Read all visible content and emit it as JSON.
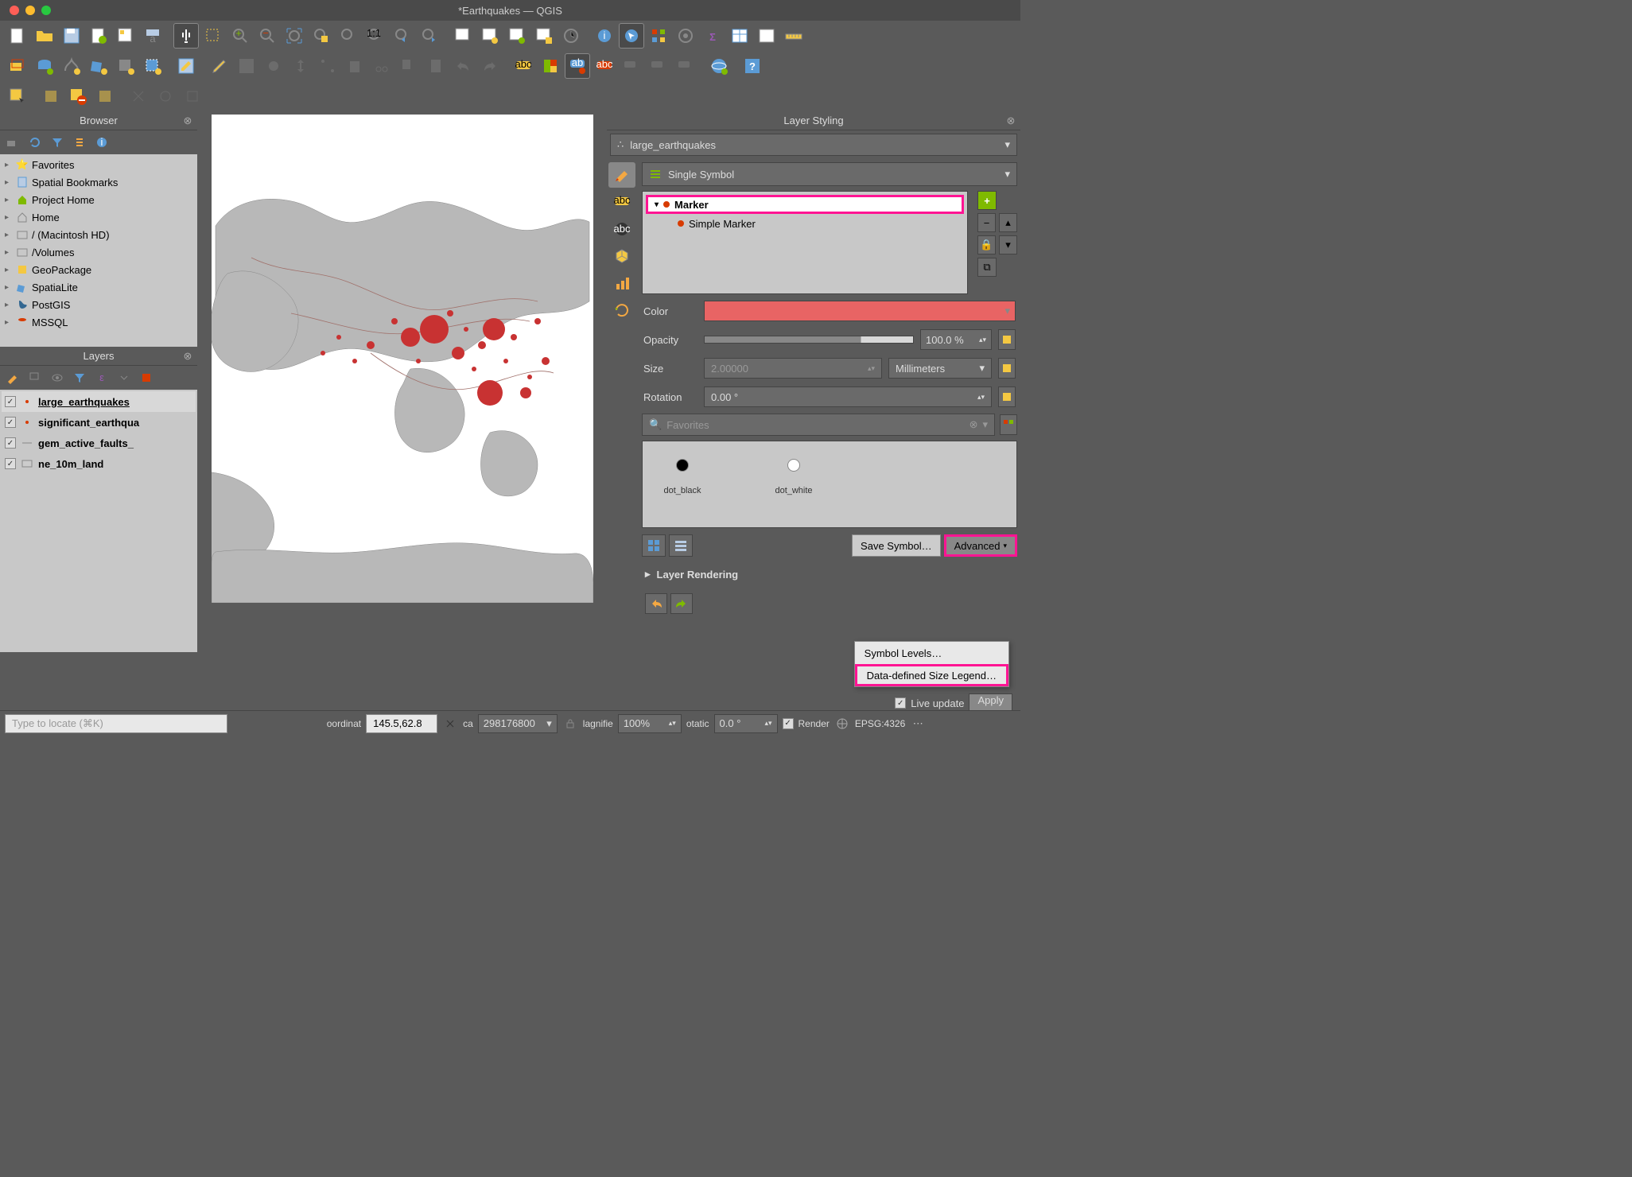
{
  "window": {
    "title": "*Earthquakes — QGIS"
  },
  "browser": {
    "title": "Browser",
    "items": [
      {
        "label": "Favorites",
        "icon": "star"
      },
      {
        "label": "Spatial Bookmarks",
        "icon": "bookmark"
      },
      {
        "label": "Project Home",
        "icon": "home-green"
      },
      {
        "label": "Home",
        "icon": "home"
      },
      {
        "label": "/ (Macintosh HD)",
        "icon": "folder"
      },
      {
        "label": "/Volumes",
        "icon": "folder"
      },
      {
        "label": "GeoPackage",
        "icon": "geopackage"
      },
      {
        "label": "SpatiaLite",
        "icon": "spatialite"
      },
      {
        "label": "PostGIS",
        "icon": "postgis"
      },
      {
        "label": "MSSQL",
        "icon": "mssql"
      }
    ]
  },
  "layers": {
    "title": "Layers",
    "items": [
      {
        "name": "large_earthquakes",
        "checked": true,
        "selected": true,
        "underline": true
      },
      {
        "name": "significant_earthqua",
        "checked": true
      },
      {
        "name": "gem_active_faults_",
        "checked": true
      },
      {
        "name": "ne_10m_land",
        "checked": true
      }
    ]
  },
  "styling": {
    "title": "Layer Styling",
    "layer": "large_earthquakes",
    "symbol_type": "Single Symbol",
    "tree": {
      "marker": "Marker",
      "simple_marker": "Simple Marker"
    },
    "props": {
      "color_label": "Color",
      "opacity_label": "Opacity",
      "opacity_value": "100.0 %",
      "size_label": "Size",
      "size_value": "2.00000",
      "size_unit": "Millimeters",
      "rotation_label": "Rotation",
      "rotation_value": "0.00 °"
    },
    "favorites_label": "Favorites",
    "favorites": [
      {
        "name": "dot_black",
        "color": "#000"
      },
      {
        "name": "dot_white",
        "color": "#fff"
      }
    ],
    "save_symbol": "Save Symbol…",
    "advanced": "Advanced",
    "menu": {
      "symbol_levels": "Symbol Levels…",
      "data_defined": "Data-defined Size Legend…"
    },
    "layer_rendering": "Layer Rendering",
    "live_update": "Live update",
    "apply": "Apply"
  },
  "statusbar": {
    "locate_placeholder": "Type to locate (⌘K)",
    "coord_label": "oordinat",
    "coord_value": "145.5,62.8",
    "scale_label": "ca",
    "scale_value": "298176800",
    "magnifier_label": "lagnifie",
    "magnifier_value": "100%",
    "rotation_label": "otatic",
    "rotation_value": "0.0 °",
    "render": "Render",
    "crs": "EPSG:4326"
  }
}
